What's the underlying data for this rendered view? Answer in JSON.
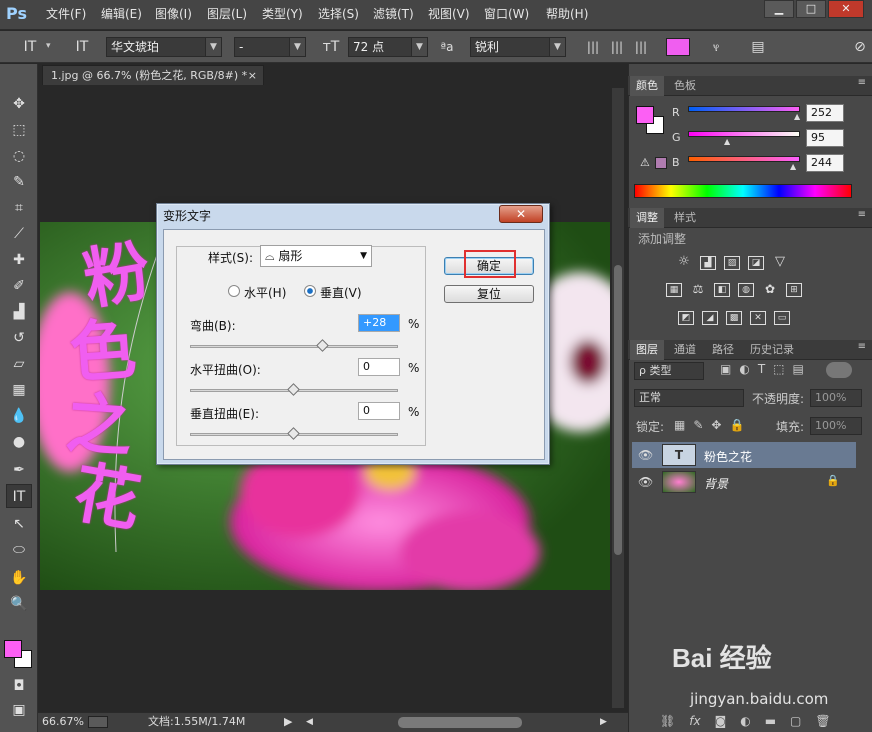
{
  "app": {
    "logo": "Ps"
  },
  "menu": [
    "文件(F)",
    "编辑(E)",
    "图像(I)",
    "图层(L)",
    "类型(Y)",
    "选择(S)",
    "滤镜(T)",
    "视图(V)",
    "窗口(W)",
    "帮助(H)"
  ],
  "window_controls": {
    "minimize": "▁",
    "maximize": "□",
    "close": "✕"
  },
  "options": {
    "font_family": "华文琥珀",
    "font_style": "-",
    "font_size": "72 点",
    "aa_label": "ªa",
    "antialias": "锐利",
    "text_color": "#f05ef0"
  },
  "document": {
    "tab_title": "1.jpg @ 66.7% (粉色之花, RGB/8#) *",
    "tab_close": "×",
    "canvas_text": [
      "粉",
      "色",
      "之",
      "花"
    ],
    "text_color": "#f05ef0"
  },
  "status": {
    "zoom": "66.67%",
    "doc": "文档:1.55M/1.74M",
    "play": "▶",
    "prev": "◀",
    "next": "▶"
  },
  "color_panel": {
    "tabs": [
      "颜色",
      "色板"
    ],
    "labels": [
      "R",
      "G",
      "B"
    ],
    "values": [
      "252",
      "95",
      "244"
    ],
    "fg_color": "#fc5ff4",
    "bg_color": "#ffffff",
    "warning": "⚠"
  },
  "adjust_panel": {
    "tabs": [
      "调整",
      "样式"
    ],
    "title": "添加调整"
  },
  "layers_panel": {
    "tabs": [
      "图层",
      "通道",
      "路径",
      "历史记录"
    ],
    "filter": "ρ 类型",
    "blend_mode": "正常",
    "opacity_label": "不透明度:",
    "opacity": "100%",
    "lock_label": "锁定:",
    "fill_label": "填充:",
    "fill": "100%",
    "layers": [
      {
        "name": "粉色之花",
        "type": "T"
      },
      {
        "name": "背景",
        "type": "image"
      }
    ],
    "bottom_icons": [
      "link-icon",
      "fx-icon",
      "mask-icon",
      "adjustment-icon",
      "folder-icon",
      "new-layer-icon",
      "trash-icon"
    ],
    "fx_label": "fx"
  },
  "dialog": {
    "title": "变形文字",
    "close": "✕",
    "style_label": "样式(S):",
    "style_value": "扇形",
    "horizontal_label": "水平(H)",
    "vertical_label": "垂直(V)",
    "orientation": "vertical",
    "bend_label": "弯曲(B):",
    "bend_value": "+28",
    "bend": 28,
    "hdist_label": "水平扭曲(O):",
    "hdist_value": "0",
    "hdist": 0,
    "vdist_label": "垂直扭曲(E):",
    "vdist_value": "0",
    "vdist": 0,
    "percent": "%",
    "ok": "确定",
    "reset": "复位",
    "highlight_color": "#e03030"
  },
  "watermark": {
    "brand": "Bai 经验",
    "url": "jingyan.baidu.com"
  }
}
